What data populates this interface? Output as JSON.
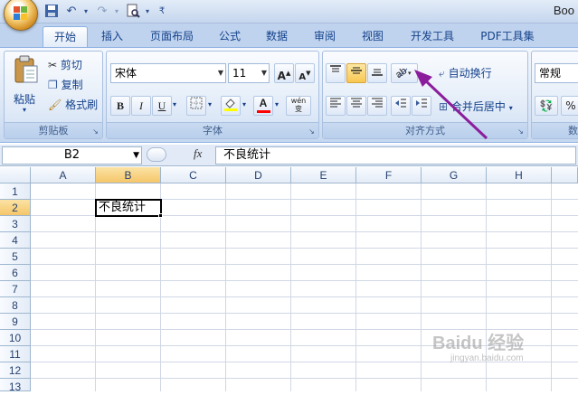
{
  "title_bar": {
    "app_title": "Boo"
  },
  "tabs": [
    "开始",
    "插入",
    "页面布局",
    "公式",
    "数据",
    "审阅",
    "视图",
    "开发工具",
    "PDF工具集"
  ],
  "active_tab": 0,
  "clipboard": {
    "paste_label": "粘贴",
    "cut_label": "剪切",
    "copy_label": "复制",
    "format_painter_label": "格式刷",
    "group_label": "剪贴板"
  },
  "font": {
    "font_name": "宋体",
    "font_size": "11",
    "group_label": "字体",
    "bold": "B",
    "italic": "I",
    "underline": "U",
    "phonetic": "wén 变"
  },
  "alignment": {
    "wrap_text_label": "自动换行",
    "merge_label": "合并后居中",
    "group_label": "对齐方式"
  },
  "number": {
    "format_value": "常规",
    "percent": "%",
    "group_label": "数"
  },
  "formula_bar": {
    "name_box": "B2",
    "fx": "fx",
    "formula_value": "不良统计"
  },
  "sheet": {
    "columns": [
      "A",
      "B",
      "C",
      "D",
      "E",
      "F",
      "G",
      "H"
    ],
    "rows": [
      "1",
      "2",
      "3",
      "4",
      "5",
      "6",
      "7",
      "8",
      "9",
      "10",
      "11",
      "12",
      "13"
    ],
    "selected_column": "B",
    "selected_row": "2",
    "active_cell_value": "不良统计"
  },
  "watermark": {
    "text": "Baidu 经验",
    "url": "jingyan.baidu.com"
  },
  "colors": {
    "ribbon_bg": "#d7e4f5",
    "highlight": "#f8c851",
    "arrow": "#8b1d9c"
  }
}
